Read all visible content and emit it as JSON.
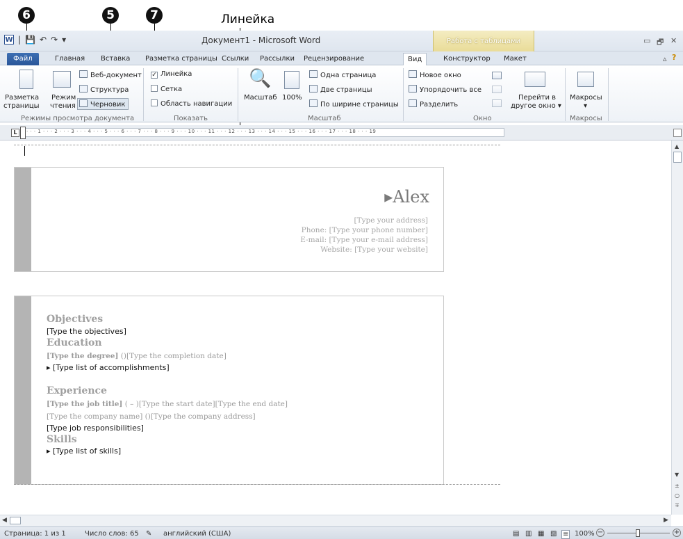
{
  "callouts": {
    "c6": "6",
    "c5": "5",
    "c7": "7",
    "ruler_label": "Линейка"
  },
  "titlebar": {
    "title": "Документ1 - Microsoft Word",
    "contextual": "Работа с таблицами",
    "qat_sep": "|",
    "minimize": "▭",
    "restore": "🗗",
    "close": "✕"
  },
  "tabs": [
    "Файл",
    "Главная",
    "Вставка",
    "Разметка страницы",
    "Ссылки",
    "Рассылки",
    "Рецензирование",
    "Вид",
    "Конструктор",
    "Макет"
  ],
  "ribbon": {
    "view_modes": {
      "page_layout": [
        "Разметка",
        "страницы"
      ],
      "reading": [
        "Режим",
        "чтения"
      ],
      "web": "Веб-документ",
      "outline": "Структура",
      "draft": "Черновик",
      "group": "Режимы просмотра документа"
    },
    "show": {
      "ruler": "Линейка",
      "ruler_checked": "✓",
      "grid": "Сетка",
      "nav": "Область навигации",
      "group": "Показать"
    },
    "zoom": {
      "zoom": "Масштаб",
      "hundred": "100%",
      "one_page": "Одна страница",
      "two_pages": "Две страницы",
      "page_width": "По ширине страницы",
      "group": "Масштаб"
    },
    "window": {
      "new_window": "Новое окно",
      "arrange": "Упорядочить все",
      "split": "Разделить",
      "switch": [
        "Перейти в",
        "другое окно ▾"
      ],
      "group": "Окно"
    },
    "macros": {
      "label": "Макросы",
      "arrow": "▾",
      "group": "Макросы"
    }
  },
  "ruler": "· · · 1 · · · 2 · · · 3 · · · 4 · · · 5 · · · 6 · · · 7 · · · 8 · · · 9 · · · 10 · · · 11 · · · 12 · · · 13 · · · 14 · · · 15 · · · 16 · · · 17 · · · 18 · · · 19",
  "document": {
    "name": "▸Alex",
    "address": "[Type your address]",
    "phone": "Phone: [Type your phone number]",
    "email": "E-mail: [Type your e-mail address]",
    "website": "Website: [Type your website]",
    "objectives_h": "Objectives",
    "objectives": "[Type the objectives]",
    "education_h": "Education",
    "degree_bold": "[Type the degree]",
    "degree_rest": " ()[Type the completion date]",
    "accomplishments": "▸   [Type list of accomplishments]",
    "experience_h": "Experience",
    "job_bold": "[Type the job title]",
    "job_rest": " ( – )[Type the start date][Type the end date]",
    "company": "[Type the company name] ()[Type the company address]",
    "responsibilities": "[Type job responsibilities]",
    "skills_h": "Skills",
    "skills": "▸   [Type list of skills]"
  },
  "status": {
    "page": "Страница: 1 из 1",
    "words": "Число слов: 65",
    "lang": "английский (США)",
    "zoom": "100%",
    "minus": "−",
    "plus": "+"
  }
}
